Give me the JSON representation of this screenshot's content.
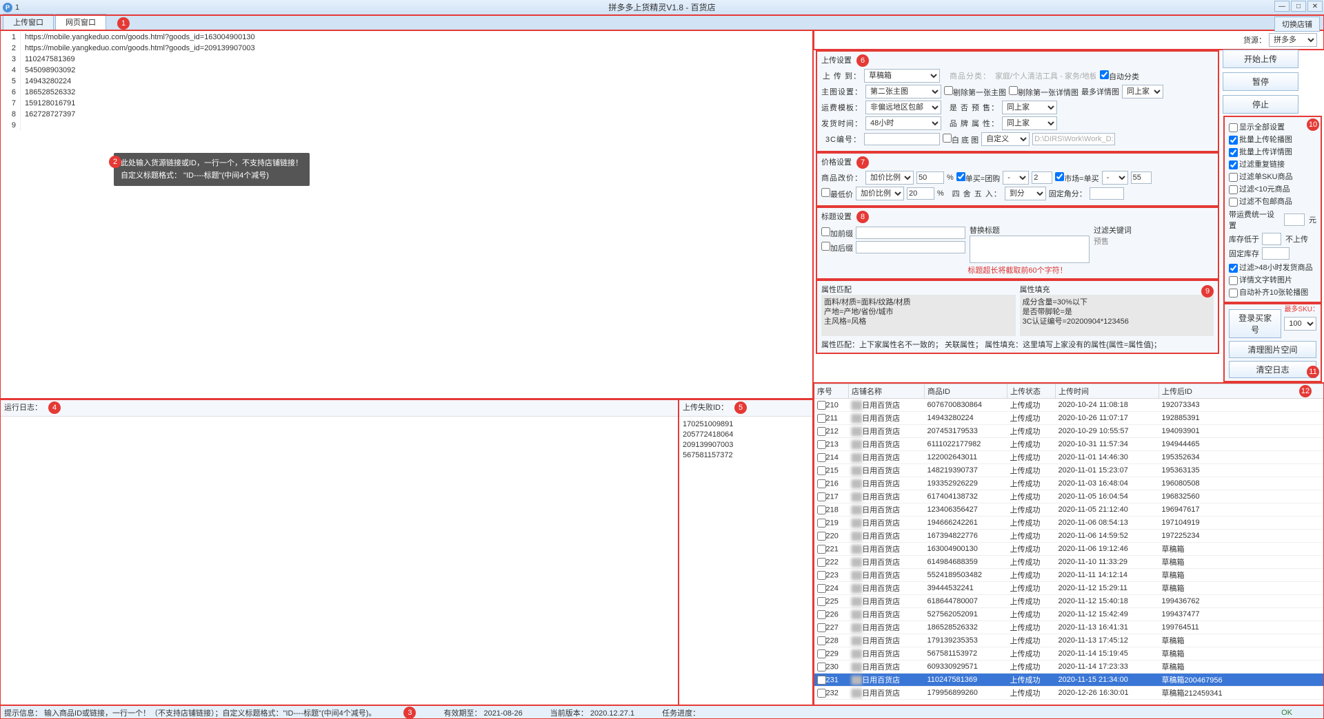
{
  "window": {
    "num": "1",
    "center_title": "拼多多上货精灵V1.8 -        百货店"
  },
  "win_btns": {
    "min": "—",
    "max": "□",
    "close": "✕"
  },
  "tabs": {
    "upload": "上传窗口",
    "web": "网页窗口"
  },
  "switch_shop": "切换店铺",
  "editor": {
    "lines": [
      "https://mobile.yangkeduo.com/goods.html?goods_id=163004900130",
      "https://mobile.yangkeduo.com/goods.html?goods_id=209139907003",
      "110247581369",
      "545098903092",
      "14943280224",
      "186528526332",
      "159128016791",
      "162728727397",
      ""
    ],
    "tooltip_l1": "此处输入货源链接或ID，一行一个，不支持店铺链接！",
    "tooltip_l2": "自定义标题格式： \"ID----标题\"(中间4个减号)"
  },
  "log_head": "运行日志：",
  "fail_head": "上传失败ID：",
  "fail_ids": [
    "170251009891",
    "205772418064",
    "209139907003",
    "567581157372"
  ],
  "source": {
    "label": "货源：",
    "value": "拼多多"
  },
  "btns": {
    "start": "开始上传",
    "pause": "暂停",
    "stop": "停止",
    "login": "登录买家号",
    "clear_img": "清理图片空间",
    "clear_log": "清空日志"
  },
  "upload_set": {
    "title": "上传设置",
    "to": "上 传 到：",
    "to_v": "草稿箱",
    "cat_lbl": "商品分类：",
    "cat_v": "家庭/个人清洁工具 - 家务/地板",
    "auto_cat": "自动分类",
    "mainimg": "主图设置：",
    "mainimg_v": "第二张主图",
    "del1": "剔除第一张主图",
    "del2": "剔除第一张详情图",
    "maxdetail_lbl": "最多详情图",
    "maxdetail_v": "同上家",
    "ship_tpl": "运费模板：",
    "ship_tpl_v": "非偏远地区包邮",
    "presale": "是 否 预 售：",
    "presale_v": "同上家",
    "ship_time": "发货时间：",
    "ship_time_v": "48小时",
    "brand": "品 牌 属 性：",
    "brand_v": "同上家",
    "code3c": "3C编号：",
    "whiteimg": "白 底 图",
    "whiteimg_v": "自定义",
    "path": "D:\\DIRS\\Work\\Work_D:"
  },
  "price_set": {
    "title": "价格设置",
    "modprice": "商品改价：",
    "mod_type": "加价比例",
    "mod_val": "50",
    "pct": "%",
    "single_group": "单买=团购",
    "sg_op": "-",
    "sg_val": "2",
    "market_single": "市场=单买",
    "ms_op": "-",
    "ms_val": "55",
    "lowest": "最低价",
    "low_type": "加价比例",
    "low_val": "20",
    "round": "四 舍 五 入：",
    "round_v": "到分",
    "fixed_dec": "固定角分："
  },
  "title_set": {
    "title": "标题设置",
    "prefix": "加前缀",
    "suffix": "加后缀",
    "replace": "替换标题",
    "filter": "过滤关键词",
    "presale_kw": "预售",
    "hint": "标题超长将截取前60个字符！"
  },
  "attr_set": {
    "match_title": "属性匹配",
    "fill_title": "属性填充",
    "match_txt": "面料/材质=面料/纹路/材质\n产地=产地/省份/城市\n主风格=风格",
    "fill_txt": "成分含量=30%以下\n是否带脚轮=是\n3C认证编号=20200904*123456",
    "foot": "属性匹配：上下家属性名不一致的；  关联属性；   属性填充：这里填写上家没有的属性{属性=属性值}；"
  },
  "opts": {
    "o0": "显示全部设置",
    "o1": "批量上传轮播图",
    "o2": "批量上传详情图",
    "o3": "过滤重复链接",
    "o4": "过滤单SKU商品",
    "o5": "过滤<10元商品",
    "o6": "过滤不包邮商品",
    "ship_unify": "带运费统一设置",
    "yuan": "元",
    "stock_lt": "库存低于",
    "no_up": "不上传",
    "fix_stock": "固定库存",
    "o7": "过滤>48小时发货商品",
    "o8": "详情文字转图片",
    "o9": "自动补齐10张轮播图",
    "max_sku": "最多SKU：",
    "max_sku_v": "100"
  },
  "table": {
    "headers": {
      "seq": "序号",
      "shop": "店铺名称",
      "goods": "商品ID",
      "status": "上传状态",
      "time": "上传时间",
      "after": "上传后ID"
    },
    "rows": [
      {
        "seq": "210",
        "shop": "日用百货店",
        "goods": "6076700830864",
        "status": "上传成功",
        "time": "2020-10-24 11:08:18",
        "after": "192073343"
      },
      {
        "seq": "211",
        "shop": "日用百货店",
        "goods": "14943280224",
        "status": "上传成功",
        "time": "2020-10-26 11:07:17",
        "after": "192885391"
      },
      {
        "seq": "212",
        "shop": "日用百货店",
        "goods": "207453179533",
        "status": "上传成功",
        "time": "2020-10-29 10:55:57",
        "after": "194093901"
      },
      {
        "seq": "213",
        "shop": "日用百货店",
        "goods": "6111022177982",
        "status": "上传成功",
        "time": "2020-10-31 11:57:34",
        "after": "194944465"
      },
      {
        "seq": "214",
        "shop": "日用百货店",
        "goods": "122002643011",
        "status": "上传成功",
        "time": "2020-11-01 14:46:30",
        "after": "195352634"
      },
      {
        "seq": "215",
        "shop": "日用百货店",
        "goods": "148219390737",
        "status": "上传成功",
        "time": "2020-11-01 15:23:07",
        "after": "195363135"
      },
      {
        "seq": "216",
        "shop": "日用百货店",
        "goods": "193352926229",
        "status": "上传成功",
        "time": "2020-11-03 16:48:04",
        "after": "196080508"
      },
      {
        "seq": "217",
        "shop": "日用百货店",
        "goods": "617404138732",
        "status": "上传成功",
        "time": "2020-11-05 16:04:54",
        "after": "196832560"
      },
      {
        "seq": "218",
        "shop": "日用百货店",
        "goods": "123406356427",
        "status": "上传成功",
        "time": "2020-11-05 21:12:40",
        "after": "196947617"
      },
      {
        "seq": "219",
        "shop": "日用百货店",
        "goods": "194666242261",
        "status": "上传成功",
        "time": "2020-11-06 08:54:13",
        "after": "197104919"
      },
      {
        "seq": "220",
        "shop": "日用百货店",
        "goods": "167394822776",
        "status": "上传成功",
        "time": "2020-11-06 14:59:52",
        "after": "197225234"
      },
      {
        "seq": "221",
        "shop": "日用百货店",
        "goods": "163004900130",
        "status": "上传成功",
        "time": "2020-11-06 19:12:46",
        "after": "草稿箱"
      },
      {
        "seq": "222",
        "shop": "日用百货店",
        "goods": "614984688359",
        "status": "上传成功",
        "time": "2020-11-10 11:33:29",
        "after": "草稿箱"
      },
      {
        "seq": "223",
        "shop": "日用百货店",
        "goods": "5524189503482",
        "status": "上传成功",
        "time": "2020-11-11 14:12:14",
        "after": "草稿箱"
      },
      {
        "seq": "224",
        "shop": "日用百货店",
        "goods": "39444532241",
        "status": "上传成功",
        "time": "2020-11-12 15:29:11",
        "after": "草稿箱"
      },
      {
        "seq": "225",
        "shop": "日用百货店",
        "goods": "618644780007",
        "status": "上传成功",
        "time": "2020-11-12 15:40:18",
        "after": "199436762"
      },
      {
        "seq": "226",
        "shop": "日用百货店",
        "goods": "527562052091",
        "status": "上传成功",
        "time": "2020-11-12 15:42:49",
        "after": "199437477"
      },
      {
        "seq": "227",
        "shop": "日用百货店",
        "goods": "186528526332",
        "status": "上传成功",
        "time": "2020-11-13 16:41:31",
        "after": "199764511"
      },
      {
        "seq": "228",
        "shop": "日用百货店",
        "goods": "179139235353",
        "status": "上传成功",
        "time": "2020-11-13 17:45:12",
        "after": "草稿箱"
      },
      {
        "seq": "229",
        "shop": "日用百货店",
        "goods": "567581153972",
        "status": "上传成功",
        "time": "2020-11-14 15:19:45",
        "after": "草稿箱"
      },
      {
        "seq": "230",
        "shop": "日用百货店",
        "goods": "609330929571",
        "status": "上传成功",
        "time": "2020-11-14 17:23:33",
        "after": "草稿箱"
      },
      {
        "seq": "231",
        "shop": "日用百货店",
        "goods": "110247581369",
        "status": "上传成功",
        "time": "2020-11-15 21:34:00",
        "after": "草稿箱200467956"
      },
      {
        "seq": "232",
        "shop": "日用百货店",
        "goods": "179956899260",
        "status": "上传成功",
        "time": "2020-12-26 16:30:01",
        "after": "草稿箱212459341"
      }
    ]
  },
  "status": {
    "tip": "提示信息：  输入商品ID或链接，一行一个！（不支持店铺链接）；自定义标题格式：\"ID----标题\"(中间4个减号)。",
    "expire": "有效期至：  2021-08-26",
    "ver": "当前版本：  2020.12.27.1",
    "task": "任务进度：",
    "ok": "OK"
  },
  "badges": {
    "b1": "1",
    "b2": "2",
    "b3": "3",
    "b4": "4",
    "b5": "5",
    "b6": "6",
    "b7": "7",
    "b8": "8",
    "b9": "9",
    "b10": "10",
    "b11": "11",
    "b12": "12"
  }
}
